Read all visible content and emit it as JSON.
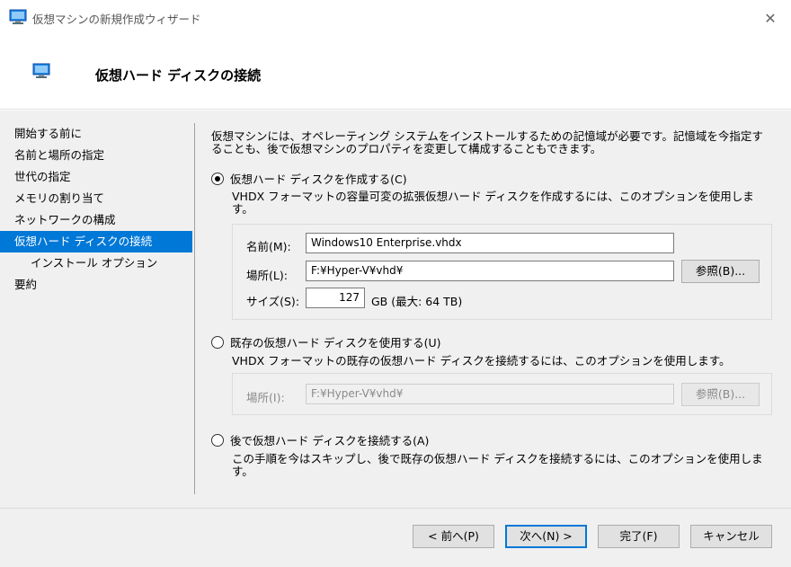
{
  "window": {
    "title": "仮想マシンの新規作成ウィザード",
    "close_glyph": "✕"
  },
  "header": {
    "title": "仮想ハード ディスクの接続"
  },
  "nav": {
    "items": [
      {
        "label": "開始する前に"
      },
      {
        "label": "名前と場所の指定"
      },
      {
        "label": "世代の指定"
      },
      {
        "label": "メモリの割り当て"
      },
      {
        "label": "ネットワークの構成"
      },
      {
        "label": "仮想ハード ディスクの接続"
      },
      {
        "label": "インストール オプション"
      },
      {
        "label": "要約"
      }
    ]
  },
  "intro": {
    "line1": "仮想マシンには、オペレーティング システムをインストールするための記憶域が必要です。記憶域を今指定す",
    "line2": "ることも、後で仮想マシンのプロパティを変更して構成することもできます。"
  },
  "option_create": {
    "label": "仮想ハード ディスクを作成する(C)",
    "selected": true,
    "desc_line1": "VHDX フォーマットの容量可変の拡張仮想ハード ディスクを作成するには、このオプションを使用しま",
    "desc_line2": "す。",
    "name_label": "名前(M):",
    "name_value": "Windows10 Enterprise.vhdx",
    "location_label": "場所(L):",
    "location_value": "F:¥Hyper-V¥vhd¥",
    "browse_label": "参照(B)...",
    "size_label": "サイズ(S):",
    "size_value": "127",
    "size_unit": "GB (最大: 64 TB)"
  },
  "option_existing": {
    "label": "既存の仮想ハード ディスクを使用する(U)",
    "selected": false,
    "desc": "VHDX フォーマットの既存の仮想ハード ディスクを接続するには、このオプションを使用します。",
    "location_label": "場所(I):",
    "location_value": "F:¥Hyper-V¥vhd¥",
    "browse_label": "参照(B)..."
  },
  "option_later": {
    "label": "後で仮想ハード ディスクを接続する(A)",
    "selected": false,
    "desc_line1": "この手順を今はスキップし、後で既存の仮想ハード ディスクを接続するには、このオプションを使用しま",
    "desc_line2": "す。"
  },
  "footer": {
    "back_label": "< 前へ(P)",
    "next_label": "次へ(N) >",
    "finish_label": "完了(F)",
    "cancel_label": "キャンセル"
  },
  "colors": {
    "accent": "#0078d7",
    "panel_bg": "#f0f0f0"
  }
}
